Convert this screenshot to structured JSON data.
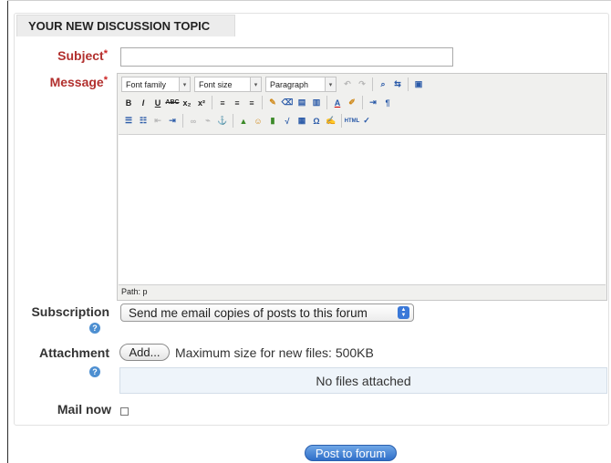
{
  "legend": "YOUR NEW DISCUSSION TOPIC",
  "subject": {
    "label": "Subject",
    "required_marker": "*",
    "value": ""
  },
  "message": {
    "label": "Message",
    "required_marker": "*",
    "toolbar": {
      "font_family": "Font family",
      "font_size": "Font size",
      "format": "Paragraph"
    },
    "path_label": "Path: p"
  },
  "subscription": {
    "label": "Subscription",
    "selected": "Send me email copies of posts to this forum"
  },
  "attachment": {
    "label": "Attachment",
    "add_button": "Add...",
    "max_size": "Maximum size for new files: 500KB",
    "files_status": "No files attached"
  },
  "mail_now": {
    "label": "Mail now",
    "checked": false
  },
  "submit_button": "Post to forum",
  "colors": {
    "required_label": "#b2302e",
    "help_icon": "#4d8fd1",
    "submit": "#3a78d8",
    "files_box_bg": "#eef4fa"
  }
}
